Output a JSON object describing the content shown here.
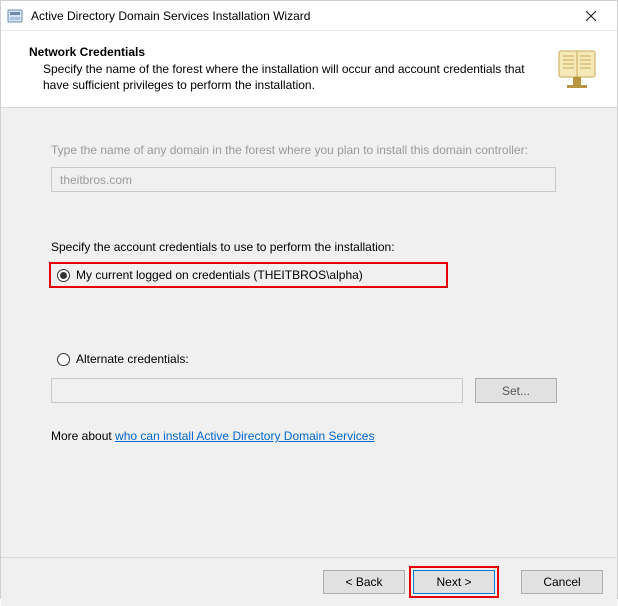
{
  "window": {
    "title": "Active Directory Domain Services Installation Wizard"
  },
  "header": {
    "title": "Network Credentials",
    "description": "Specify the name of the forest where the installation will occur and account credentials that have sufficient privileges to perform the installation."
  },
  "content": {
    "domain_prompt": "Type the name of any domain in the forest where you plan to install this domain controller:",
    "domain_value": "theitbros.com",
    "creds_prompt": "Specify the account credentials to use to perform the installation:",
    "radio_current": "My current logged on credentials (THEITBROS\\alpha)",
    "radio_alternate": "Alternate credentials:",
    "alt_value": "",
    "set_label": "Set...",
    "more_prefix": "More about ",
    "more_link": "who can install Active Directory Domain Services"
  },
  "footer": {
    "back": "< Back",
    "next": "Next >",
    "cancel": "Cancel"
  }
}
